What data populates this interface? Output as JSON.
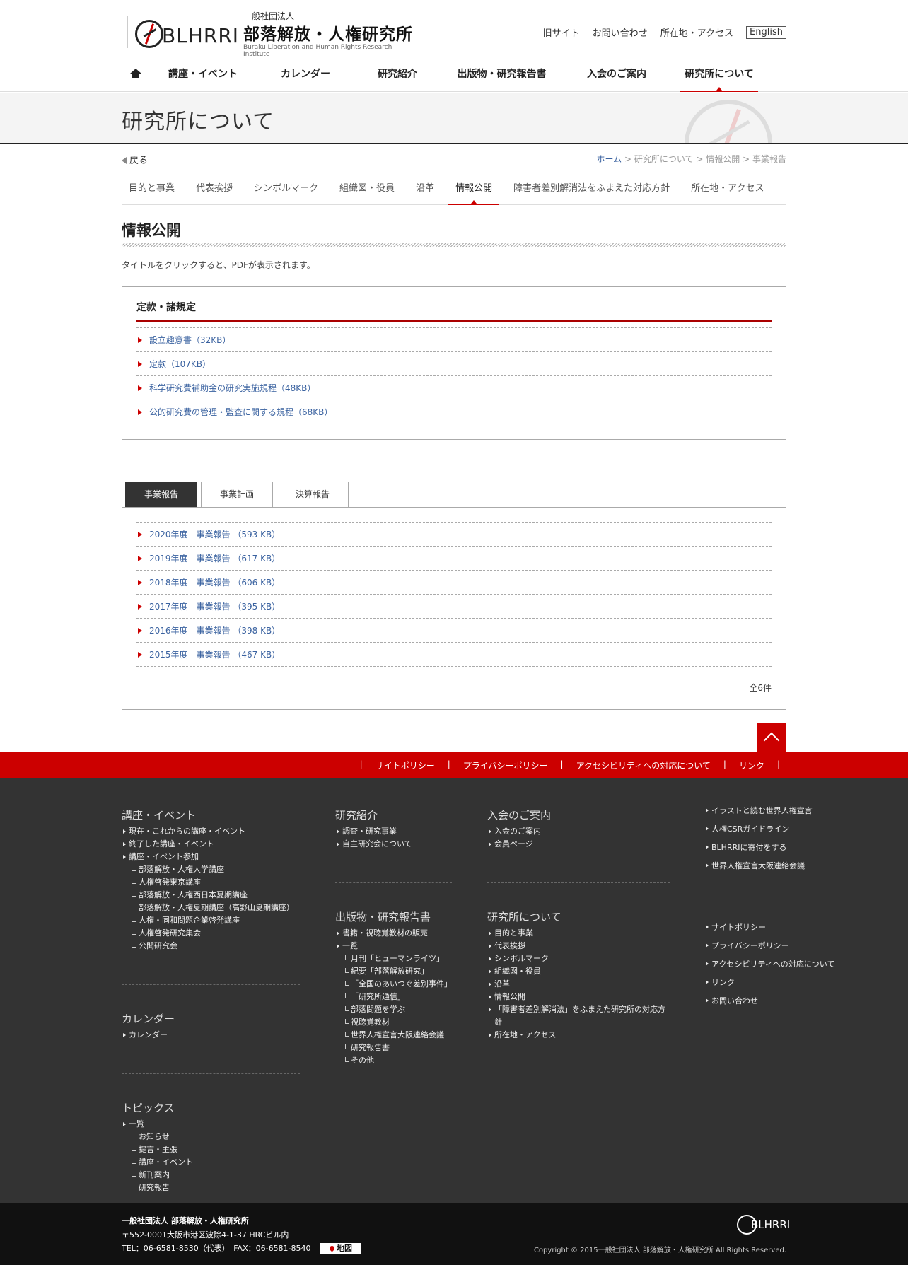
{
  "header": {
    "logo_letters": "BLHRRI",
    "logo_sub": "一般社団法人",
    "logo_main": "部落解放・人権研究所",
    "logo_en": "Buraku Liberation and Human Rights Research Institute",
    "toplinks": [
      "旧サイト",
      "お問い合わせ",
      "所在地・アクセス"
    ],
    "english": "English",
    "gnav": [
      "講座・イベント",
      "カレンダー",
      "研究紹介",
      "出版物・研究報告書",
      "入会のご案内",
      "研究所について"
    ]
  },
  "page_title": "研究所について",
  "back": "戻る",
  "breadcrumb": {
    "home": "ホーム",
    "items": [
      "研究所について",
      "情報公開",
      "事業報告"
    ],
    "sep": ">"
  },
  "subnav": [
    "目的と事業",
    "代表挨拶",
    "シンボルマーク",
    "組織図・役員",
    "沿革",
    "情報公開",
    "障害者差別解消法をふまえた対応方針",
    "所在地・アクセス"
  ],
  "section_title": "情報公開",
  "note": "タイトルをクリックすると、PDFが表示されます。",
  "rules_box": {
    "title": "定款・諸規定",
    "items": [
      "設立趣意書（32KB）",
      "定款（107KB）",
      "科学研究費補助金の研究実施規程（48KB）",
      "公的研究費の管理・監査に関する規程（68KB）"
    ]
  },
  "tabs": [
    "事業報告",
    "事業計画",
    "決算報告"
  ],
  "reports": {
    "items": [
      "2020年度　事業報告 （593 KB）",
      "2019年度　事業報告 （617 KB）",
      "2018年度　事業報告 （606 KB）",
      "2017年度　事業報告 （395 KB）",
      "2016年度　事業報告 （398 KB）",
      "2015年度　事業報告 （467 KB）"
    ],
    "count": "全6件"
  },
  "redbar": [
    "|",
    "サイトポリシー",
    "|",
    "プライバシーポリシー",
    "|",
    "アクセシビリティへの対応について",
    "|",
    "リンク",
    "|"
  ],
  "footer": {
    "col1": {
      "h1": "講座・イベント",
      "l1": [
        "現在・これからの講座・イベント",
        "終了した講座・イベント",
        "講座・イベント参加"
      ],
      "s1": [
        "部落解放・人権大学講座",
        "人権啓発東京講座",
        "部落解放・人権西日本夏期講座",
        "部落解放・人権夏期講座（高野山夏期講座）",
        "人権・同和問題企業啓発講座",
        "人権啓発研究集会",
        "公開研究会"
      ],
      "h2": "カレンダー",
      "l2": [
        "カレンダー"
      ],
      "h3": "トピックス",
      "l3": [
        "一覧"
      ],
      "s3": [
        "お知らせ",
        "提言・主張",
        "講座・イベント",
        "新刊案内",
        "研究報告"
      ]
    },
    "col2": {
      "h1": "研究紹介",
      "l1": [
        "調査・研究事業",
        "自主研究会について"
      ],
      "h2": "出版物・研究報告書",
      "l2": [
        "書籍・視聴覚教材の販売",
        "一覧"
      ],
      "s2": [
        "月刊「ヒューマンライツ」",
        "紀要「部落解放研究」",
        "「全国のあいつぐ差別事件」",
        "「研究所通信」",
        "部落問題を学ぶ",
        "視聴覚教材",
        "世界人権宣言大阪連絡会議",
        "研究報告書",
        "その他"
      ]
    },
    "col3": {
      "h1": "入会のご案内",
      "l1": [
        "入会のご案内",
        "会員ページ"
      ],
      "h2": "研究所について",
      "l2": [
        "目的と事業",
        "代表挨拶",
        "シンボルマーク",
        "組織図・役員",
        "沿革",
        "情報公開",
        "「障害者差別解消法」をふまえた研究所の対応方針",
        "所在地・アクセス"
      ]
    },
    "col4": {
      "a": [
        "イラストと読む世界人権宣言",
        "人権CSRガイドライン",
        "BLHRRIに寄付をする",
        "世界人権宣言大阪連絡会議"
      ],
      "b": [
        "サイトポリシー",
        "プライバシーポリシー",
        "アクセシビリティへの対応について",
        "リンク",
        "お問い合わせ"
      ]
    }
  },
  "bottom": {
    "org": "一般社団法人 部落解放・人権研究所",
    "addr": "〒552-0001大阪市港区波除4-1-37 HRCビル内",
    "tel": "TEL：06-6581-8530（代表）　FAX：06-6581-8540",
    "map": "地図",
    "logo": "BLHRRI",
    "copy": "Copyright © 2015一般社団法人 部落解放・人権研究所 All Rights Reserved."
  },
  "colors": {
    "accent": "#cc0000",
    "link": "#3a62a0",
    "footer_bg": "#333333",
    "bottom_bg": "#111111"
  }
}
